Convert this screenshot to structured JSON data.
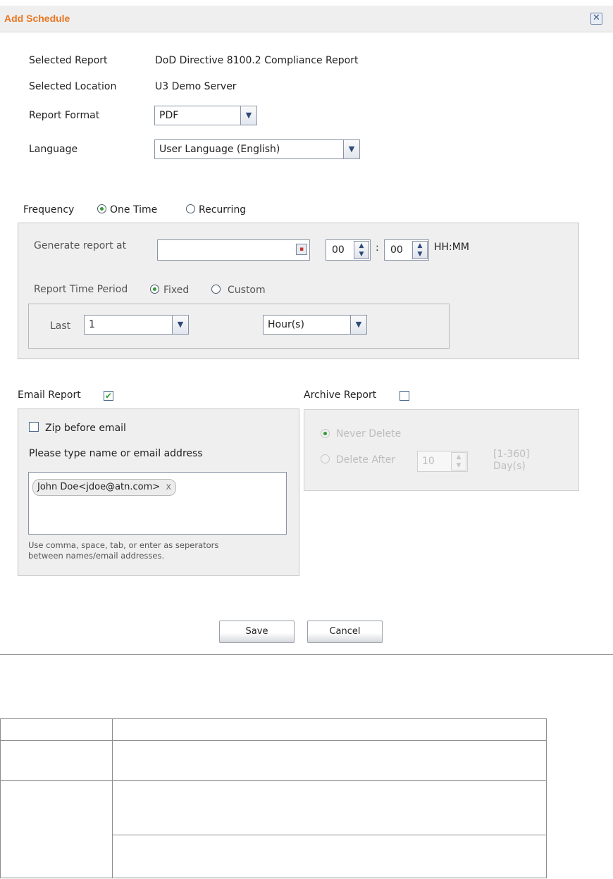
{
  "dialog": {
    "title": "Add Schedule",
    "close_glyph": "✕"
  },
  "report": {
    "selected_report_label": "Selected Report",
    "selected_report_value": "DoD Directive 8100.2 Compliance Report",
    "selected_location_label": "Selected Location",
    "selected_location_value": "U3 Demo Server",
    "format_label": "Report Format",
    "format_value": "PDF",
    "language_label": "Language",
    "language_value": "User Language (English)"
  },
  "frequency": {
    "label": "Frequency",
    "options": [
      "One Time",
      "Recurring"
    ],
    "selected": "One Time",
    "generate_label": "Generate report at",
    "date_value": "",
    "hour_value": "00",
    "minute_value": "00",
    "time_separator": ":",
    "time_format": "HH:MM",
    "period_label": "Report Time Period",
    "period_options": [
      "Fixed",
      "Custom"
    ],
    "period_selected": "Fixed",
    "last_label": "Last",
    "last_value": "1",
    "unit_value": "Hour(s)"
  },
  "email": {
    "label": "Email Report",
    "checked": true,
    "zip_label": "Zip before email",
    "zip_checked": false,
    "prompt": "Please type name or email address",
    "recipients": [
      "John Doe<jdoe@atn.com>"
    ],
    "remove_glyph": "x",
    "help_line1": "Use comma, space, tab, or enter as seperators",
    "help_line2": "between names/email addresses."
  },
  "archive": {
    "label": "Archive Report",
    "checked": false,
    "never_delete": "Never Delete",
    "delete_after": "Delete After",
    "days_value": "10",
    "range": "[1-360]",
    "unit": "Day(s)"
  },
  "buttons": {
    "save": "Save",
    "cancel": "Cancel"
  },
  "colors": {
    "title": "#e87722",
    "panel": "#efefef",
    "check": "#2f9e2f"
  }
}
